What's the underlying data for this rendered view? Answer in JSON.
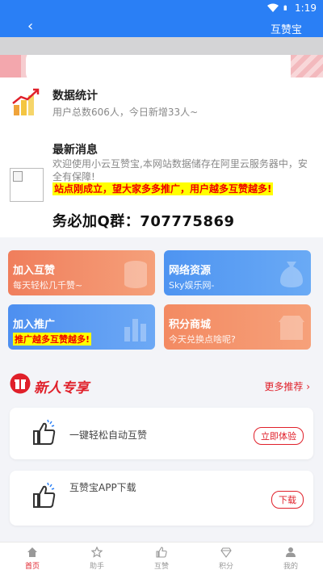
{
  "status_bar": {
    "time": "1:19"
  },
  "app_bar": {
    "title": "互赞宝",
    "back_glyph": "‹"
  },
  "stats": {
    "title": "数据统计",
    "desc": "用户总数606人，今日新增33人~"
  },
  "news": {
    "title": "最新消息",
    "desc": "欢迎使用小云互赞宝,本网站数据储存在阿里云服务器中，安全有保障!",
    "highlight": "站点刚成立，望大家多多推广，用户越多互赞越多!"
  },
  "qq_group": "务必加Q群：707775869",
  "tiles": [
    {
      "title": "加入互赞",
      "sub": "每天轻松几千赞~"
    },
    {
      "title": "网络资源",
      "sub": "Sky娱乐网-"
    },
    {
      "title": "加入推广",
      "sub": "推广越多互赞越多!"
    },
    {
      "title": "积分商城",
      "sub": "今天兑换点啥呢?"
    }
  ],
  "section": {
    "title": "新人专享",
    "more": "更多推荐 ›"
  },
  "tasks": [
    {
      "label": "一键轻松自动互赞",
      "button": "立即体验"
    },
    {
      "label": "互赞宝APP下载",
      "button": "下载"
    }
  ],
  "tabs": [
    {
      "label": "首页",
      "icon": "home-icon"
    },
    {
      "label": "助手",
      "icon": "star-icon"
    },
    {
      "label": "互赞",
      "icon": "thumb-icon"
    },
    {
      "label": "积分",
      "icon": "diamond-icon"
    },
    {
      "label": "我的",
      "icon": "user-icon"
    }
  ],
  "colors": {
    "primary": "#2a7ff5",
    "accent": "#e0202a",
    "orange": "#f07e5c",
    "highlight": "#ffff00"
  }
}
